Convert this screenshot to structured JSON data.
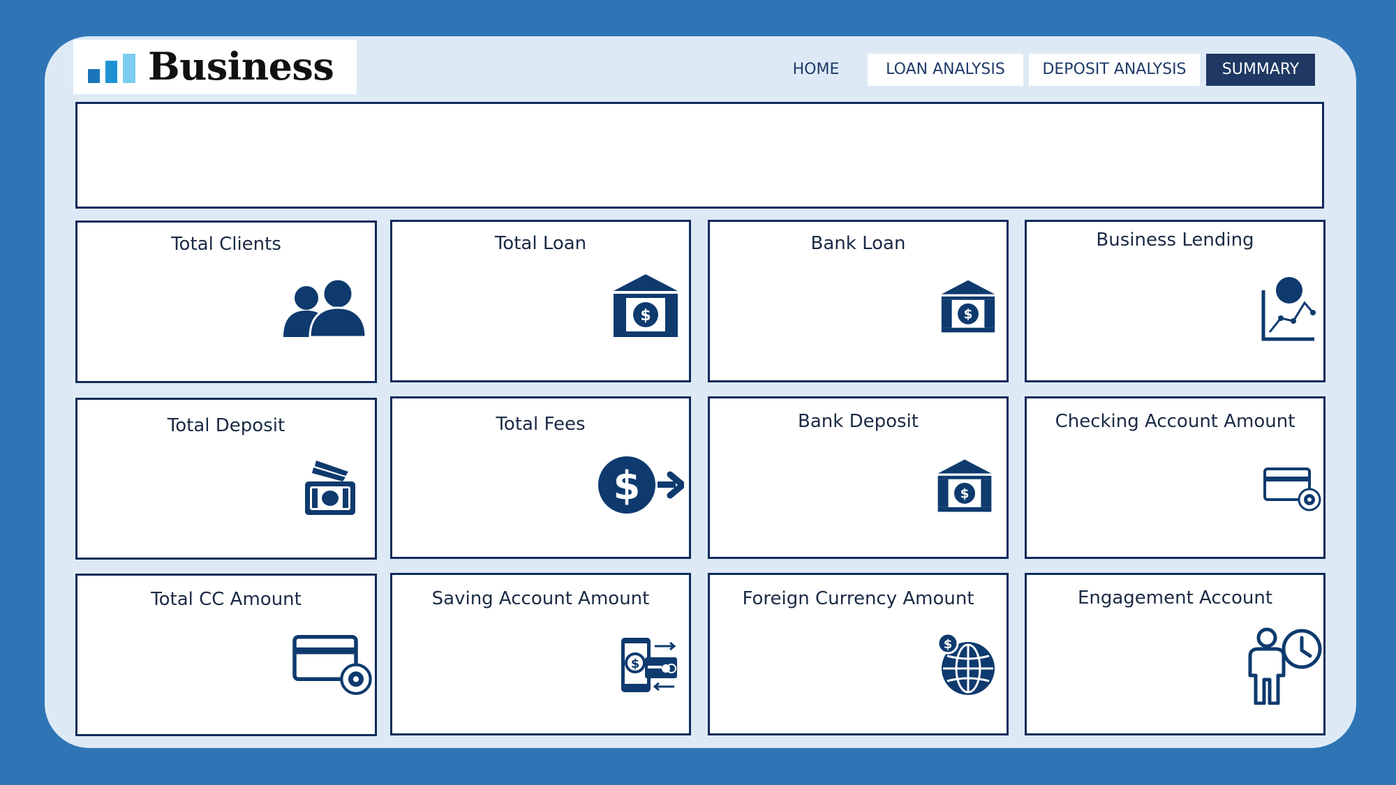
{
  "brand": {
    "name": "Business"
  },
  "nav": {
    "home": "HOME",
    "loan_analysis": "LOAN ANALYSIS",
    "deposit_analysis": "DEPOSIT ANALYSIS",
    "summary": "SUMMARY"
  },
  "colors": {
    "background": "#2f75b5",
    "panel": "#ddeaf6",
    "card_border": "#0f2b5b",
    "icon": "#0e3a6e",
    "nav_active": "#1f3864"
  },
  "cards": [
    {
      "title": "Total Clients",
      "icon": "users-icon"
    },
    {
      "title": "Total Loan",
      "icon": "bank-icon"
    },
    {
      "title": "Bank Loan",
      "icon": "bank-icon"
    },
    {
      "title": "Business Lending",
      "icon": "growth-chart-icon"
    },
    {
      "title": "Total Deposit",
      "icon": "cash-icon"
    },
    {
      "title": "Total Fees",
      "icon": "dollar-transfer-icon"
    },
    {
      "title": "Bank Deposit",
      "icon": "bank-icon"
    },
    {
      "title": "Checking Account Amount",
      "icon": "credit-card-settings-icon"
    },
    {
      "title": "Total CC Amount",
      "icon": "credit-card-settings-icon"
    },
    {
      "title": "Saving Account Amount",
      "icon": "mobile-payment-icon"
    },
    {
      "title": "Foreign Currency Amount",
      "icon": "globe-dollar-icon"
    },
    {
      "title": "Engagement Account",
      "icon": "person-clock-icon"
    }
  ]
}
